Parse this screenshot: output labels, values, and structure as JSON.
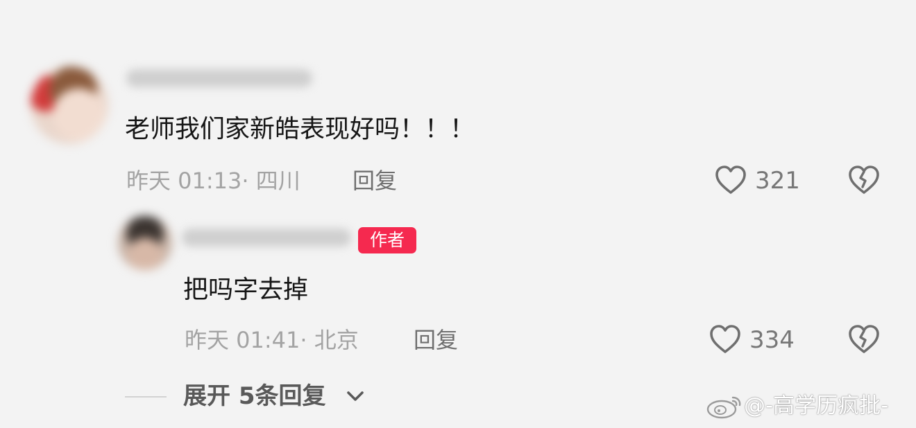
{
  "comments": [
    {
      "text": "老师我们家新皓表现好吗！！！",
      "time": "昨天 01:13· 四川",
      "reply_label": "回复",
      "likes": "321"
    }
  ],
  "reply": {
    "author_badge": "作者",
    "text": "把吗字去掉",
    "time": "昨天 01:41· 北京",
    "reply_label": "回复",
    "likes": "334"
  },
  "expand": {
    "label": "展开 5条回复"
  },
  "watermark": {
    "text": "@-高学历疯批-"
  },
  "icons": {
    "like": "heart-outline-icon",
    "dislike": "broken-heart-icon",
    "expand": "chevron-down-icon",
    "watermark": "weibo-logo-icon"
  },
  "colors": {
    "background": "#f3f3f3",
    "author_badge": "#f5294f",
    "meta_text": "#a3a3a3"
  }
}
